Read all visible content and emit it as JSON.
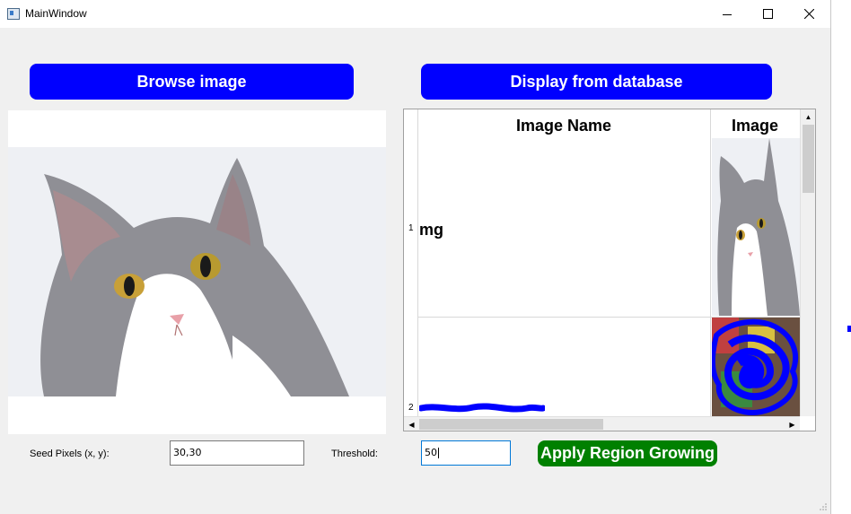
{
  "window": {
    "title": "MainWindow"
  },
  "buttons": {
    "browse_label": "Browse image",
    "display_label": "Display from database",
    "apply_label": "Apply Region Growing"
  },
  "table": {
    "headers": [
      "Image Name",
      "Image"
    ],
    "rows": [
      {
        "number": "1",
        "name": "mg"
      },
      {
        "number": "2",
        "name": ""
      }
    ]
  },
  "controls": {
    "seed_label": "Seed Pixels (x, y):",
    "seed_value": "30,30",
    "threshold_label": "Threshold:",
    "threshold_value": "50"
  },
  "icons": [
    "app-icon",
    "minimize-icon",
    "maximize-icon",
    "close-icon",
    "scroll-up-icon",
    "scroll-down-icon",
    "scroll-left-icon",
    "scroll-right-icon",
    "size-grip-icon"
  ],
  "colors": {
    "primary_button": "#0000ff",
    "apply_button": "#008000",
    "window_bg": "#f0f0f0"
  }
}
